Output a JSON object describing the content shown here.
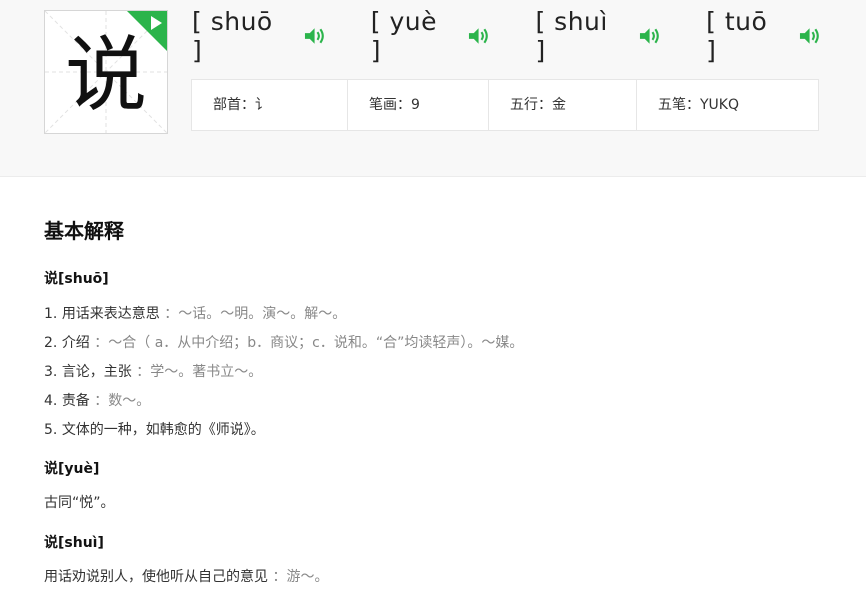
{
  "character": "说",
  "pronunciations": [
    {
      "label": "[ shuō ]",
      "icon": "speaker-icon"
    },
    {
      "label": "[ yuè ]",
      "icon": "speaker-icon"
    },
    {
      "label": "[ shuì ]",
      "icon": "speaker-icon"
    },
    {
      "label": "[ tuō ]",
      "icon": "speaker-icon"
    }
  ],
  "info": {
    "radical": "部首：讠",
    "strokes": "笔画：9",
    "wuxing": "五行：金",
    "wubi": "五笔：YUKQ"
  },
  "colors": {
    "accent": "#2bb44b"
  },
  "section_title": "基本解释",
  "entries": [
    {
      "head": "说[shuō]",
      "defs": [
        {
          "num": "1.",
          "text": "用话来表达意思",
          "example": "：～话。～明。演～。解～。"
        },
        {
          "num": "2.",
          "text": "介绍",
          "example": "：～合（ a．从中介绍；b．商议；c．说和。“合”均读轻声）。～媒。"
        },
        {
          "num": "3.",
          "text": "言论，主张",
          "example": "：学～。著书立～。"
        },
        {
          "num": "4.",
          "text": "责备",
          "example": "：数～。"
        },
        {
          "num": "5.",
          "text": "文体的一种，如韩愈的《师说》。",
          "example": ""
        }
      ]
    },
    {
      "head": "说[yuè]",
      "plain": "古同“悦”。"
    },
    {
      "head": "说[shuì]",
      "plain": "用话劝说别人，使他听从自己的意见",
      "example": "：游～。"
    }
  ]
}
